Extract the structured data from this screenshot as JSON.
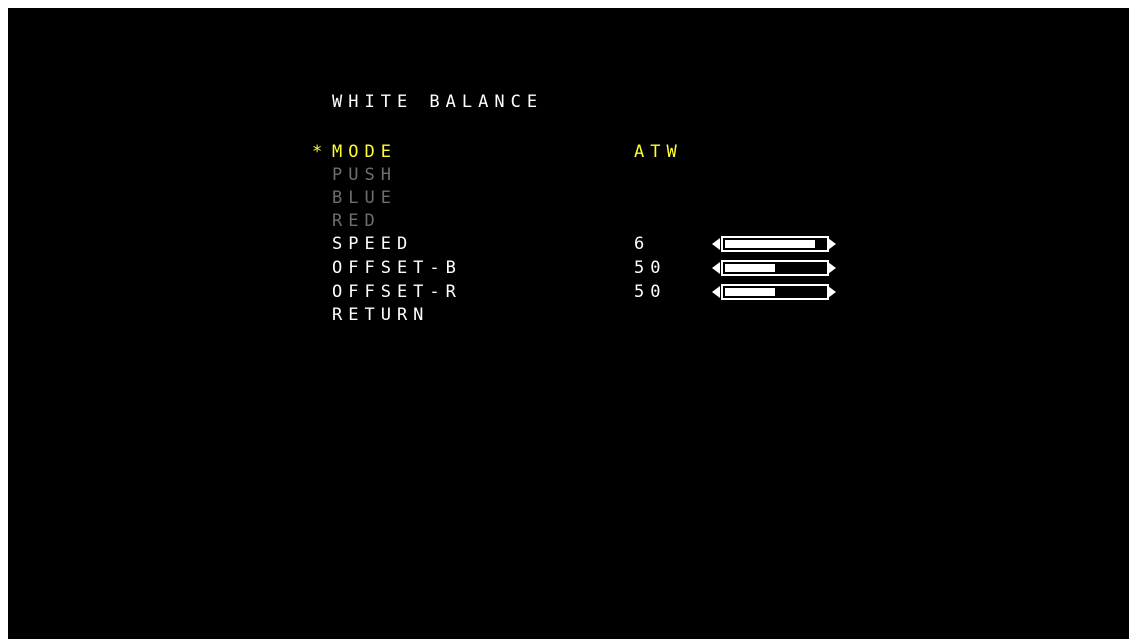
{
  "menu": {
    "title": "WHITE BALANCE",
    "cursor": "*",
    "rows": [
      {
        "label": "MODE",
        "value": "ATW",
        "state": "selected"
      },
      {
        "label": "PUSH",
        "value": "",
        "state": "disabled"
      },
      {
        "label": "BLUE",
        "value": "",
        "state": "disabled"
      },
      {
        "label": "RED",
        "value": "",
        "state": "disabled"
      },
      {
        "label": "SPEED",
        "value": "6",
        "state": "normal",
        "level": 0.9
      },
      {
        "label": "OFFSET-B",
        "value": "50",
        "state": "normal",
        "level": 0.5
      },
      {
        "label": "OFFSET-R",
        "value": "50",
        "state": "normal",
        "level": 0.5
      },
      {
        "label": "RETURN",
        "value": "",
        "state": "normal"
      }
    ]
  },
  "colors": {
    "background": "#000000",
    "text": "#ffffff",
    "highlight": "#ffff33",
    "disabled": "#6e6e6e"
  },
  "icons": [
    "arrow-left-icon",
    "arrow-right-icon"
  ]
}
